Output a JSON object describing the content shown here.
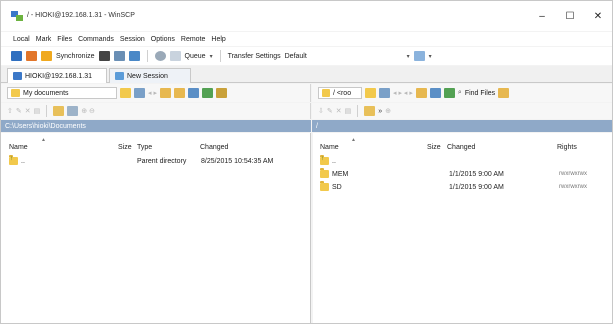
{
  "window": {
    "title": "/ - HIOKI@192.168.1.31 - WinSCP",
    "controls": {
      "minimize": "–",
      "maximize": "☐",
      "close": "✕"
    }
  },
  "menu": [
    "Local",
    "Mark",
    "Files",
    "Commands",
    "Session",
    "Options",
    "Remote",
    "Help"
  ],
  "toolbar": {
    "synchronize_label": "Synchronize",
    "queue_label": "Queue",
    "transfer_settings_label": "Transfer Settings",
    "transfer_settings_value": "Default"
  },
  "tabs": [
    {
      "label": "HIOKI@192.168.1.31"
    },
    {
      "label": "New Session"
    }
  ],
  "left_panel": {
    "location_combo": "My documents",
    "path": "C:\\Users\\hioki\\Documents",
    "columns": [
      "Name",
      "Size",
      "Type",
      "Changed"
    ],
    "rows": [
      {
        "name": "..",
        "size": "",
        "type": "Parent directory",
        "changed": "8/25/2015 10:54:35 AM"
      }
    ]
  },
  "right_panel": {
    "location_combo": "/ <roo",
    "find_files_label": "Find Files",
    "path": "/",
    "columns": [
      "Name",
      "Size",
      "Changed",
      "Rights"
    ],
    "rows": [
      {
        "name": "..",
        "size": "",
        "changed": "",
        "rights": ""
      },
      {
        "name": "MEM",
        "size": "",
        "changed": "1/1/2015 9:00 AM",
        "rights": "rwxrwxrwx"
      },
      {
        "name": "SD",
        "size": "",
        "changed": "1/1/2015 9:00 AM",
        "rights": "rwxrwxrwx"
      }
    ]
  },
  "colors": {
    "path_bar": "#8fa9c8",
    "folder": "#f2c94c"
  }
}
